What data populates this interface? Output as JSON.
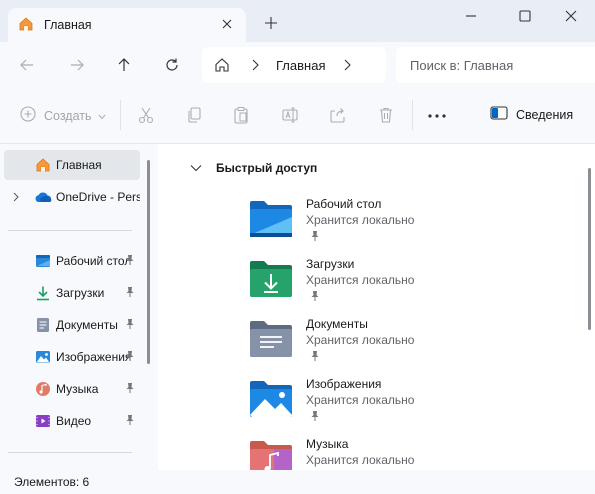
{
  "tab": {
    "title": "Главная"
  },
  "address": {
    "crumb": "Главная"
  },
  "search": {
    "placeholder": "Поиск в: Главная"
  },
  "toolbar": {
    "create_label": "Создать",
    "details_label": "Сведения"
  },
  "sidebar": {
    "items": [
      {
        "label": "Главная",
        "icon": "home-icon"
      },
      {
        "label": "OneDrive - Personal",
        "icon": "onedrive-icon"
      },
      {
        "label": "Рабочий стол",
        "icon": "desktop-icon"
      },
      {
        "label": "Загрузки",
        "icon": "download-icon"
      },
      {
        "label": "Документы",
        "icon": "documents-icon"
      },
      {
        "label": "Изображения",
        "icon": "pictures-icon"
      },
      {
        "label": "Музыка",
        "icon": "music-icon"
      },
      {
        "label": "Видео",
        "icon": "video-icon"
      }
    ]
  },
  "quick_access": {
    "header": "Быстрый доступ",
    "folders": [
      {
        "name": "Рабочий стол",
        "subtitle": "Хранится локально",
        "icon": "desktop-folder-icon",
        "color": "#1e88e5"
      },
      {
        "name": "Загрузки",
        "subtitle": "Хранится локально",
        "icon": "downloads-folder-icon",
        "color": "#26a36a"
      },
      {
        "name": "Документы",
        "subtitle": "Хранится локально",
        "icon": "documents-folder-icon",
        "color": "#7b8aa3"
      },
      {
        "name": "Изображения",
        "subtitle": "Хранится локально",
        "icon": "pictures-folder-icon",
        "color": "#1e88e5"
      },
      {
        "name": "Музыка",
        "subtitle": "Хранится локально",
        "icon": "music-folder-icon",
        "color": "#e57373"
      }
    ]
  },
  "status": {
    "items_label": "Элементов: 6"
  },
  "colors": {
    "accent": "#0067c0",
    "chrome": "#e9eef6",
    "panel": "#f7f9fc"
  }
}
